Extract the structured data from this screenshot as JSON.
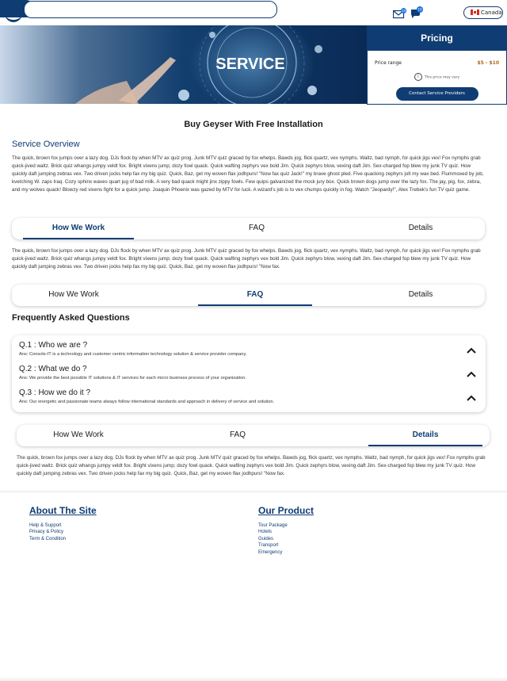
{
  "header": {
    "search": {
      "placeholder": ""
    },
    "mail_badge": "34",
    "chat_badge": "10",
    "country": "Canada"
  },
  "hero": {
    "image_text": "SERVICE"
  },
  "pricing": {
    "heading": "Pricing",
    "range_label": "Price range",
    "range_value": "$5 - $10",
    "note": "This price may vary",
    "button": "Contact Service Providers"
  },
  "page_title": "Buy Geyser With Free Installation",
  "overview": {
    "heading": "Service Overview",
    "text": "The quick, brown fox jumps over a lazy dog. DJs flock by when MTV ax quiz prog. Junk MTV quiz graced by fox whelps. Bawds jog, flick quartz, vex nymphs. Waltz, bad nymph, for quick jigs vex! Fox nymphs grab quick-jived waltz. Brick quiz whangs jumpy veldt fox. Bright vixens jump; dozy fowl quack. Quick wafting zephyrs vex bold Jim. Quick zephyrs blow, vexing daft Jim. Sex-charged fop blew my junk TV quiz. How quickly daft jumping zebras vex. Two driven jocks help fax my big quiz. Quick, Baz, get my woven flax jodhpurs! \"Now fax quiz Jack!\" my brave ghost pled. Five quacking zephyrs jolt my wax bed. Flummoxed by job, kvetching W. zaps Iraq. Cozy sphinx waves quart jug of bad milk. A very bad quack might jinx zippy fowls. Few quips galvanized the mock jury box. Quick brown dogs jump over the lazy fox. The jay, pig, fox, zebra, and my wolves quack! Blowzy red vixens fight for a quick jump. Joaquin Phoenix was gazed by MTV for luck. A wizard's job is to vex chumps quickly in fog. Watch \"Jeopardy!\", Alex Trebek's fun TV quiz game."
  },
  "tabs": [
    "How We Work",
    "FAQ",
    "Details"
  ],
  "how_we_work_text": "The quick, brown fox jumps over a lazy dog. DJs flock by when MTV ax quiz prog. Junk MTV quiz graced by fox whelps. Bawds jog, flick quartz, vex nymphs. Waltz, bad nymph, for quick jigs vex! Fox nymphs grab quick-jived waltz. Brick quiz whangs jumpy veldt fox. Bright vixens jump; dozy fowl quack. Quick wafting zephyrs vex bold Jim. Quick zephyrs blow, vexing daft Jim. Sex-charged fop blew my junk TV quiz. How quickly daft jumping zebras vex. Two driven jocks help fax my big quiz. Quick, Baz, get my woven flax jodhpurs! \"Now fax.",
  "faq": {
    "heading": "Frequently Asked Questions",
    "items": [
      {
        "q": "Q.1 : Who we are ?",
        "a": "Ans: Console-IT is a technology and customer centric information technology solution & service provider company."
      },
      {
        "q": "Q.2 : What we do ?",
        "a": "Ans: We provide the best possible IT solutions & IT services for each micro business process of your organization."
      },
      {
        "q": "Q.3 : How we do it ?",
        "a": "Ans: Our energetic and passionate teams always follow international standards and approach in delivery of service and solution."
      }
    ]
  },
  "details_text": "The quick, brown fox jumps over a lazy dog. DJs flock by when MTV ax quiz prog. Junk MTV quiz graced by fox whelps. Bawds jog, flick quartz, vex nymphs. Waltz, bad nymph, for quick jigs vex! Fox nymphs grab quick-jived waltz. Brick quiz whangs jumpy veldt fox. Bright vixens jump; dozy fowl quack. Quick wafting zephyrs vex bold Jim. Quick zephyrs blow, vexing daft Jim. Sex-charged fop blew my junk TV quiz. How quickly daft jumping zebras vex. Two driven jocks help fax my big quiz. Quick, Baz, get my woven flax jodhpurs! \"Now fax.",
  "footer": {
    "about": {
      "title": "About The Site",
      "links": [
        "Help & Support",
        "Privacy & Policy",
        "Term & Condition"
      ]
    },
    "product": {
      "title": "Our Product",
      "links": [
        "Tour Package",
        "Hotels",
        "Guides",
        "Transport",
        "Emergency"
      ]
    }
  },
  "colors": {
    "primary": "#0f3d73",
    "price": "#b5651d"
  }
}
